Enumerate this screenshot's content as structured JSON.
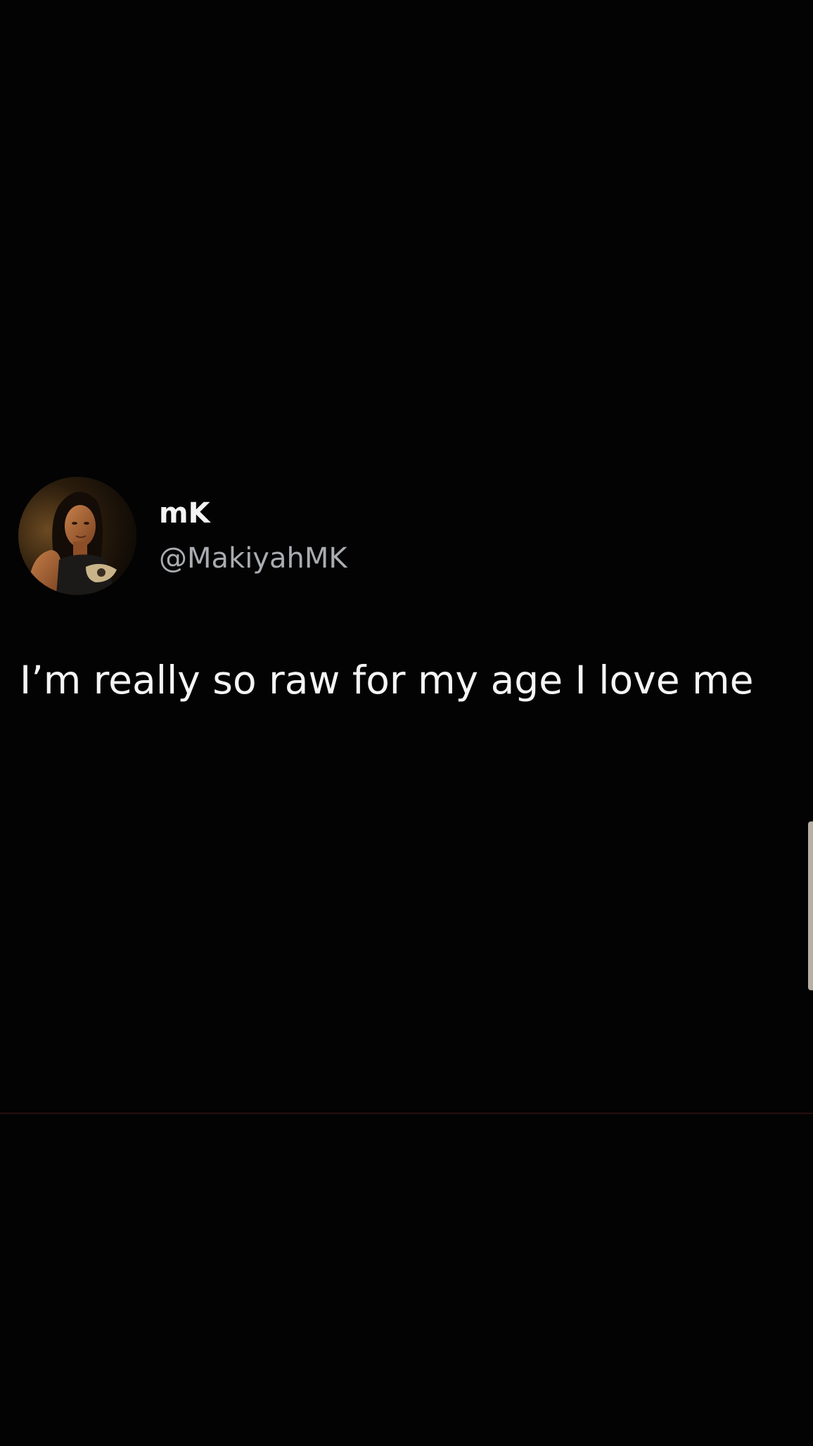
{
  "tweet": {
    "display_name": "mK",
    "handle": "@MakiyahMK",
    "text": "I’m really so raw for my age I love me",
    "avatar_icon": "profile-photo"
  },
  "colors": {
    "background": "#030303",
    "text": "#f5f5f5",
    "handle_text": "#a9acb0",
    "edge_handle": "#b8b0a4",
    "divider": "#2a0d0d"
  }
}
